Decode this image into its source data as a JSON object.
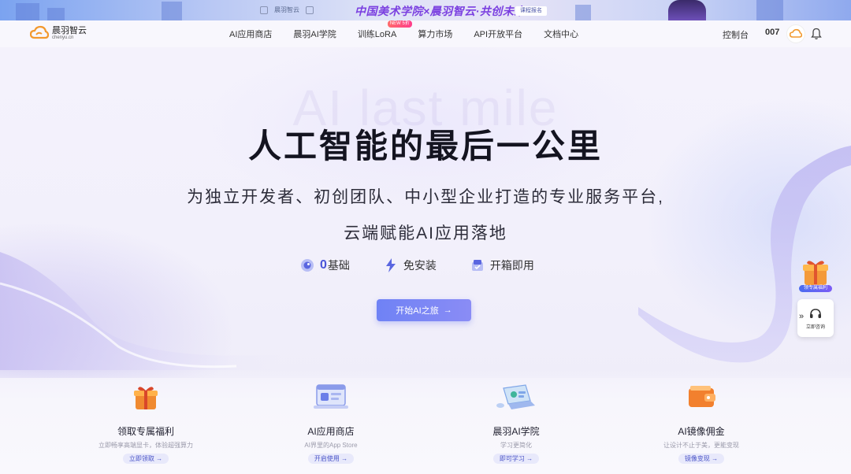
{
  "banner": {
    "logo_a": "晨羽智云",
    "slogan": "中国美术学院×晨羽智云·共创未来",
    "cta": "课程报名"
  },
  "header": {
    "brand_name": "晨羽智云",
    "brand_domain": "chenyu.cn",
    "nav": [
      {
        "label": "AI应用商店"
      },
      {
        "label": "晨羽AI学院"
      },
      {
        "label": "训练LoRA",
        "badge": "NEW 5折"
      },
      {
        "label": "算力市场"
      },
      {
        "label": "API开放平台"
      },
      {
        "label": "文档中心"
      }
    ],
    "console": "控制台",
    "user": "007"
  },
  "hero": {
    "watermark": "AI last mile",
    "title": "人工智能的最后一公里",
    "subtitle_line1": "为独立开发者、初创团队、中小型企业打造的专业服务平台,",
    "subtitle_line2": "云端赋能AI应用落地",
    "features": [
      {
        "value": "0",
        "label": "基础",
        "icon": "brain-icon"
      },
      {
        "value": "",
        "label": "免安装",
        "icon": "lightning-icon"
      },
      {
        "value": "",
        "label": "开箱即用",
        "icon": "box-icon"
      }
    ],
    "start_button": "开始AI之旅"
  },
  "side": {
    "gift_label": "领专属福利",
    "consult_label": "立即咨询"
  },
  "cards": [
    {
      "title": "领取专属福利",
      "desc": "立即畅享高端显卡，体验超强算力",
      "button": "立即领取"
    },
    {
      "title": "AI应用商店",
      "desc": "AI界里的App Store",
      "button": "开启使用"
    },
    {
      "title": "晨羽AI学院",
      "desc": "学习更简化",
      "button": "即可学习"
    },
    {
      "title": "AI镜像佣金",
      "desc": "让设计不止于美，更能变现",
      "button": "镜像变现"
    }
  ],
  "colors": {
    "accent": "#6f82f5",
    "feature_accent": "#4a55d8",
    "badge": "#ff3d8b"
  }
}
